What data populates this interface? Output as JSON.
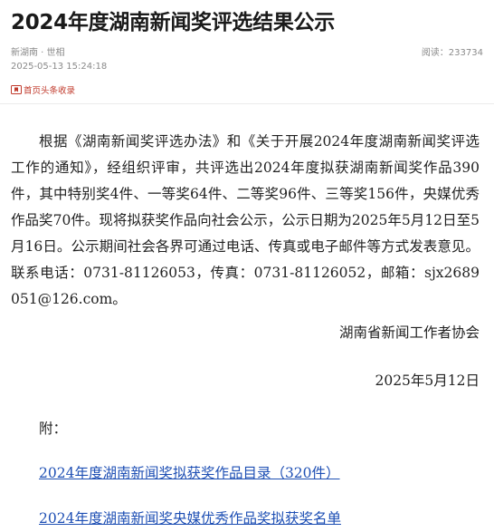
{
  "article": {
    "title": "2024年度湖南新闻奖评选结果公示",
    "source": "新湖南 · 世相",
    "publish_time": "2025-05-13 15:24:18",
    "read_count": "阅读：233734",
    "bookmark_label": "首页头条收录",
    "body": "根据《湖南新闻奖评选办法》和《关于开展2024年度湖南新闻奖评选工作的通知》，经组织评审，共评选出2024年度拟获湖南新闻奖作品390件，其中特别奖4件、一等奖64件、二等奖96件、三等奖156件，央媒优秀作品奖70件。现将拟获奖作品向社会公示，公示日期为2025年5月12日至5月16日。公示期间社会各界可通过电话、传真或电子邮件等方式发表意见。联系电话：0731-81126053，传真：0731-81126052，邮箱：sjx2689051@126.com。",
    "signature_org": "湖南省新闻工作者协会",
    "signature_date": "2025年5月12日",
    "attachment_label": "附：",
    "attachments": [
      {
        "label": "2024年度湖南新闻奖拟获奖作品目录（320件）"
      },
      {
        "label": "2024年度湖南新闻奖央媒优秀作品奖拟获奖名单"
      }
    ]
  },
  "colors": {
    "link": "#1e4fb4",
    "bookmark_accent": "#c0392b",
    "meta_text": "#8a8a8a",
    "body_text": "#222222"
  },
  "icons": {
    "bookmark": "bookmark-icon"
  }
}
